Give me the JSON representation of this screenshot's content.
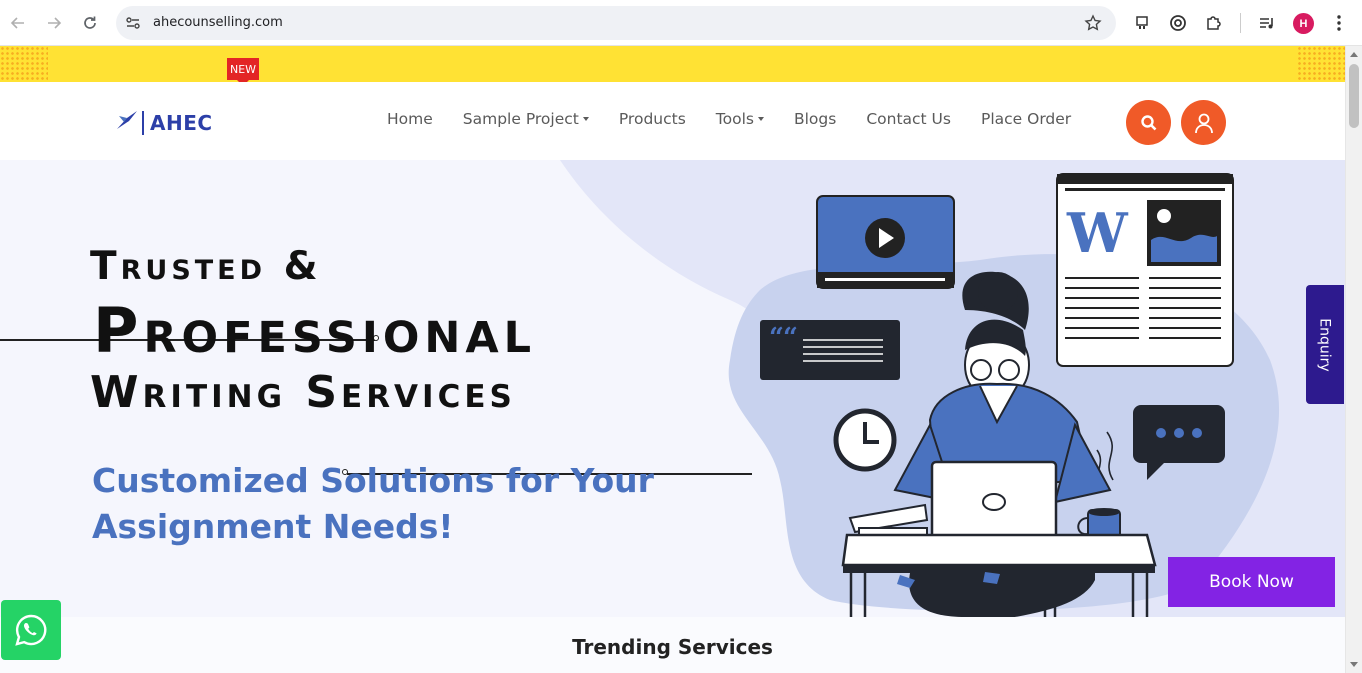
{
  "browser": {
    "url": "ahecounselling.com",
    "profile_initial": "H",
    "icons": [
      "back-icon",
      "forward-icon",
      "reload-icon",
      "site-info-icon",
      "bookmark-star-icon",
      "extension-icon",
      "extension-icon-2",
      "puzzle-extensions-icon",
      "media-control-icon",
      "kebab-menu-icon"
    ]
  },
  "promo": {
    "badge": "NEW",
    "color": "#ffe234"
  },
  "header": {
    "logo_text": "AHEC",
    "menu": [
      {
        "label": "Home",
        "dropdown": false
      },
      {
        "label": "Sample Project",
        "dropdown": true
      },
      {
        "label": "Products",
        "dropdown": false
      },
      {
        "label": "Tools",
        "dropdown": true
      },
      {
        "label": "Blogs",
        "dropdown": false
      },
      {
        "label": "Contact Us",
        "dropdown": false
      },
      {
        "label": "Place Order",
        "dropdown": false
      }
    ],
    "accent": "#f05a28"
  },
  "hero": {
    "title_line1": "Trusted &",
    "title_line2": "Professional",
    "title_line3": "Writing Services",
    "subtitle": "Customized Solutions for Your Assignment Needs!",
    "subtitle_color": "#4a72bf"
  },
  "cta": {
    "book_now": "Book Now",
    "enquiry": "Enquiry",
    "book_color": "#8323e4"
  },
  "trending": {
    "heading": "Trending Services"
  }
}
